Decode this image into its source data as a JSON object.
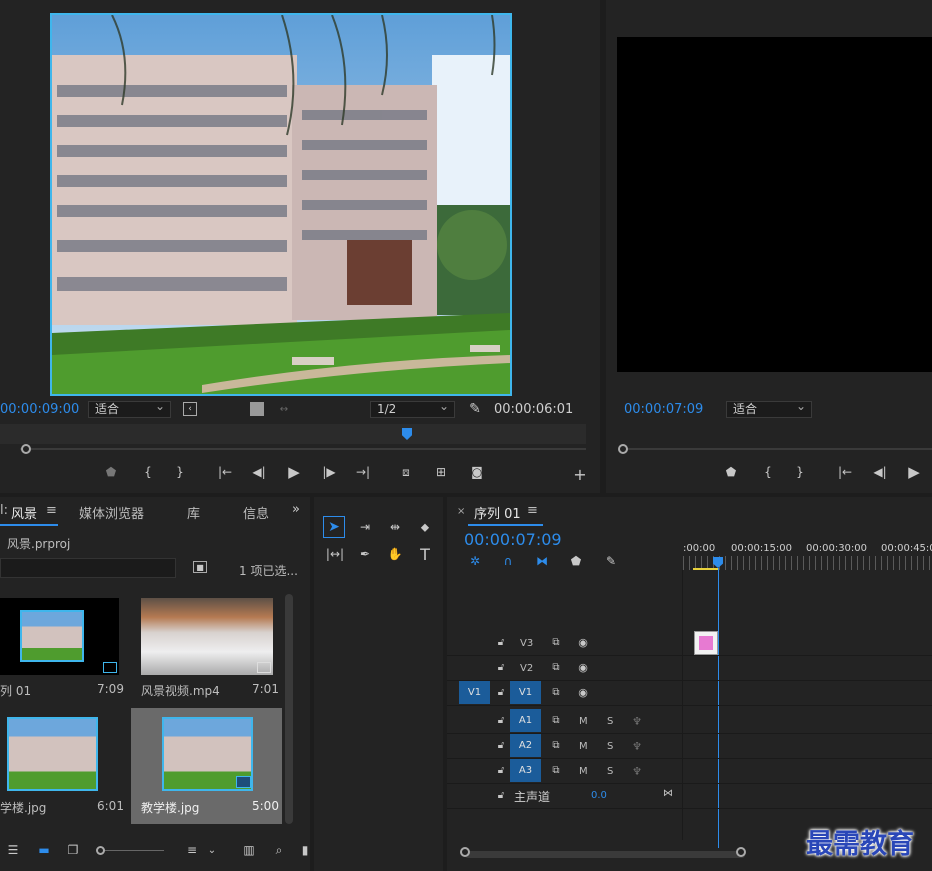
{
  "source_monitor": {
    "timecode_in": "00:00:09:00",
    "fit_label": "适合",
    "resolution": "1/2",
    "duration": "00:00:06:01"
  },
  "program_monitor": {
    "timecode": "00:00:07:09",
    "fit_label": "适合"
  },
  "project_panel": {
    "tabs": [
      "风景",
      "媒体浏览器",
      "库",
      "信息"
    ],
    "project_file": "风景.prproj",
    "selection_status": "1 项已选...",
    "items": [
      {
        "name": "列 01",
        "duration": "7:09"
      },
      {
        "name": "风景视频.mp4",
        "duration": "7:01"
      },
      {
        "name": "学楼.jpg",
        "duration": "6:01"
      },
      {
        "name": "教学楼.jpg",
        "duration": "5:00"
      }
    ]
  },
  "timeline": {
    "sequence_name": "序列 01",
    "timecode": "00:00:07:09",
    "ruler_labels": [
      ":00:00",
      "00:00:15:00",
      "00:00:30:00",
      "00:00:45:0"
    ],
    "video_tracks": [
      "V3",
      "V2",
      "V1"
    ],
    "source_target": "V1",
    "audio_tracks": [
      "A1",
      "A2",
      "A3"
    ],
    "mute_label": "M",
    "solo_label": "S",
    "master_label": "主声道",
    "master_value": "0.0"
  },
  "watermark": "最需教育"
}
